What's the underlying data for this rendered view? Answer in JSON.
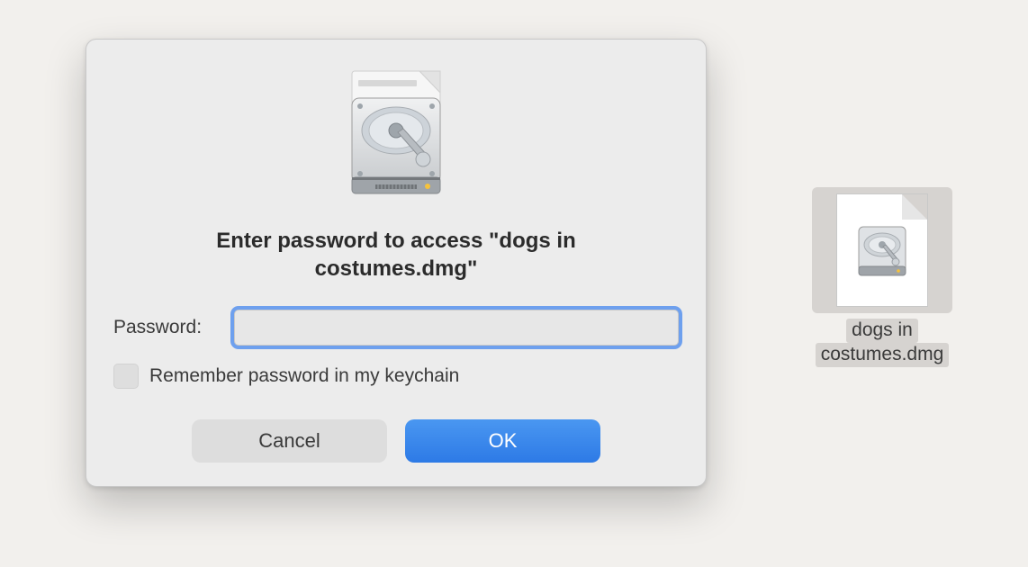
{
  "dialog": {
    "title": "Enter password to access \"dogs in costumes.dmg\"",
    "password_label": "Password:",
    "password_value": "",
    "remember_label": "Remember password in my keychain",
    "cancel_label": "Cancel",
    "ok_label": "OK",
    "icon_name": "disk-image-icon"
  },
  "desktop": {
    "file_name_line1": "dogs in",
    "file_name_line2": "costumes.dmg",
    "file_icon_name": "dmg-file-icon"
  }
}
